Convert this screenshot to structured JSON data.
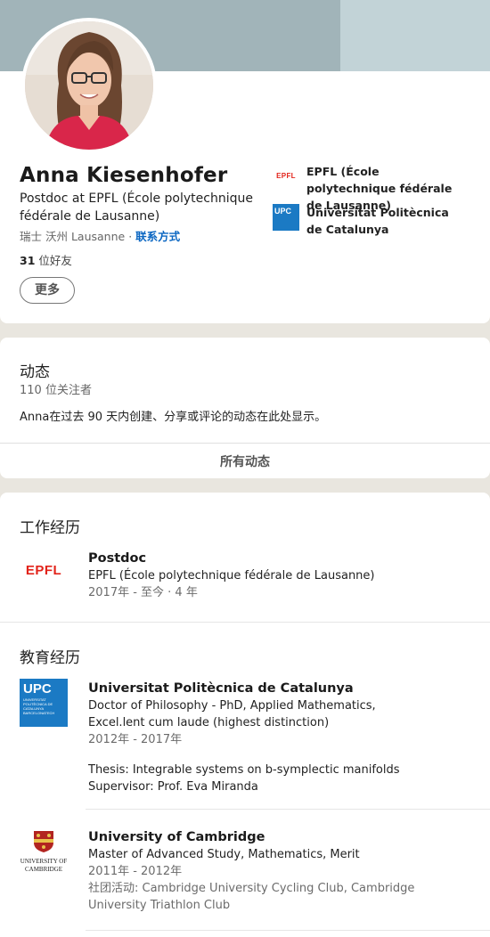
{
  "profile": {
    "name": "Anna Kiesenhofer",
    "headline": "Postdoc at EPFL (École polytechnique fédérale de Lausanne)",
    "location": "瑞士 沃州 Lausanne",
    "separator": "·",
    "contact_link": "联系方式",
    "connections_count": "31",
    "connections_label": "位好友",
    "more_button": "更多",
    "affiliations": [
      {
        "logo_text": "EPFL",
        "name": "EPFL (École polytechnique fédérale de Lausanne)"
      },
      {
        "logo_text": "UPC",
        "name": "Universitat Politècnica de Catalunya"
      }
    ]
  },
  "activity": {
    "title": "动态",
    "followers": "110 位关注者",
    "description": "Anna在过去 90 天内创建、分享或评论的动态在此处显示。",
    "all_activity": "所有动态"
  },
  "experience": {
    "title": "工作经历",
    "items": [
      {
        "logo_text": "EPFL",
        "title": "Postdoc",
        "org": "EPFL (École polytechnique fédérale de Lausanne)",
        "dates": "2017年 - 至今 · 4 年"
      }
    ]
  },
  "education": {
    "title": "教育经历",
    "items": [
      {
        "logo_text": "UPC",
        "logo_subtext": "UNIVERSITAT POLITÈCNICA DE CATALUNYA BARCELONATECH",
        "school": "Universitat Politècnica de Catalunya",
        "degree_line1": "Doctor of Philosophy - PhD, Applied Mathematics,",
        "degree_line2": "Excel.lent cum laude (highest distinction)",
        "dates": "2012年 - 2017年",
        "thesis": "Thesis: Integrable systems on b-symplectic manifolds",
        "supervisor": "Supervisor: Prof. Eva Miranda"
      },
      {
        "logo_text": "UNIVERSITY OF CAMBRIDGE",
        "logo_line1": "UNIVERSITY OF",
        "logo_line2": "CAMBRIDGE",
        "school": "University of Cambridge",
        "degree": "Master of Advanced Study, Mathematics, Merit",
        "dates": "2011年 - 2012年",
        "activities_line1": "社团活动: Cambridge University Cycling Club, Cambridge",
        "activities_line2": "University Triathlon Club"
      }
    ]
  },
  "colors": {
    "banner": "#a1b4b9",
    "banner_light": "#c2d3d7",
    "link": "#0a66c2",
    "epfl_red": "#e2231a",
    "upc_blue": "#1b7ac4",
    "page_bg": "#e9e6df"
  }
}
